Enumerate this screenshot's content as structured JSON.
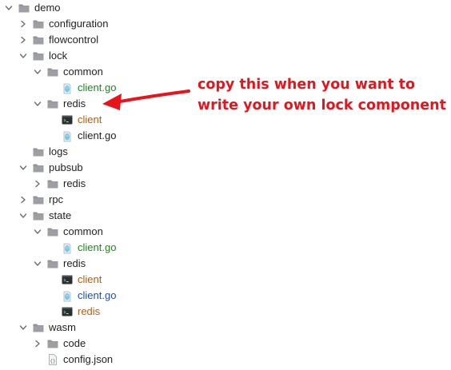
{
  "tree": [
    {
      "label": "demo",
      "type": "folder",
      "depth": 0,
      "expanded": true,
      "color": "default"
    },
    {
      "label": "configuration",
      "type": "folder",
      "depth": 1,
      "expanded": false,
      "color": "default"
    },
    {
      "label": "flowcontrol",
      "type": "folder",
      "depth": 1,
      "expanded": false,
      "color": "default"
    },
    {
      "label": "lock",
      "type": "folder",
      "depth": 1,
      "expanded": true,
      "color": "default"
    },
    {
      "label": "common",
      "type": "folder",
      "depth": 2,
      "expanded": true,
      "color": "default"
    },
    {
      "label": "client.go",
      "type": "go-file",
      "depth": 3,
      "color": "green"
    },
    {
      "label": "redis",
      "type": "folder",
      "depth": 2,
      "expanded": true,
      "color": "default"
    },
    {
      "label": "client",
      "type": "exec",
      "depth": 3,
      "color": "orange"
    },
    {
      "label": "client.go",
      "type": "go-file",
      "depth": 3,
      "color": "default"
    },
    {
      "label": "logs",
      "type": "folder",
      "depth": 1,
      "expanded": null,
      "color": "default"
    },
    {
      "label": "pubsub",
      "type": "folder",
      "depth": 1,
      "expanded": true,
      "color": "default"
    },
    {
      "label": "redis",
      "type": "folder",
      "depth": 2,
      "expanded": false,
      "color": "default"
    },
    {
      "label": "rpc",
      "type": "folder",
      "depth": 1,
      "expanded": false,
      "color": "default"
    },
    {
      "label": "state",
      "type": "folder",
      "depth": 1,
      "expanded": true,
      "color": "default"
    },
    {
      "label": "common",
      "type": "folder",
      "depth": 2,
      "expanded": true,
      "color": "default"
    },
    {
      "label": "client.go",
      "type": "go-file",
      "depth": 3,
      "color": "green"
    },
    {
      "label": "redis",
      "type": "folder",
      "depth": 2,
      "expanded": true,
      "color": "default"
    },
    {
      "label": "client",
      "type": "exec",
      "depth": 3,
      "color": "orange"
    },
    {
      "label": "client.go",
      "type": "go-file",
      "depth": 3,
      "color": "blue"
    },
    {
      "label": "redis",
      "type": "exec",
      "depth": 3,
      "color": "orange"
    },
    {
      "label": "wasm",
      "type": "folder",
      "depth": 1,
      "expanded": true,
      "color": "default"
    },
    {
      "label": "code",
      "type": "folder",
      "depth": 2,
      "expanded": false,
      "color": "default"
    },
    {
      "label": "config.json",
      "type": "json-file",
      "depth": 2,
      "color": "default"
    }
  ],
  "annotation": {
    "line1": "copy this when you want to",
    "line2": "write your own lock component",
    "color": "#e8141b"
  },
  "colors": {
    "folder": "#8e9297",
    "green": "#1b8a1b",
    "orange": "#c05a08",
    "blue": "#1a4fc4",
    "go_gopher": "#79c6e8"
  }
}
